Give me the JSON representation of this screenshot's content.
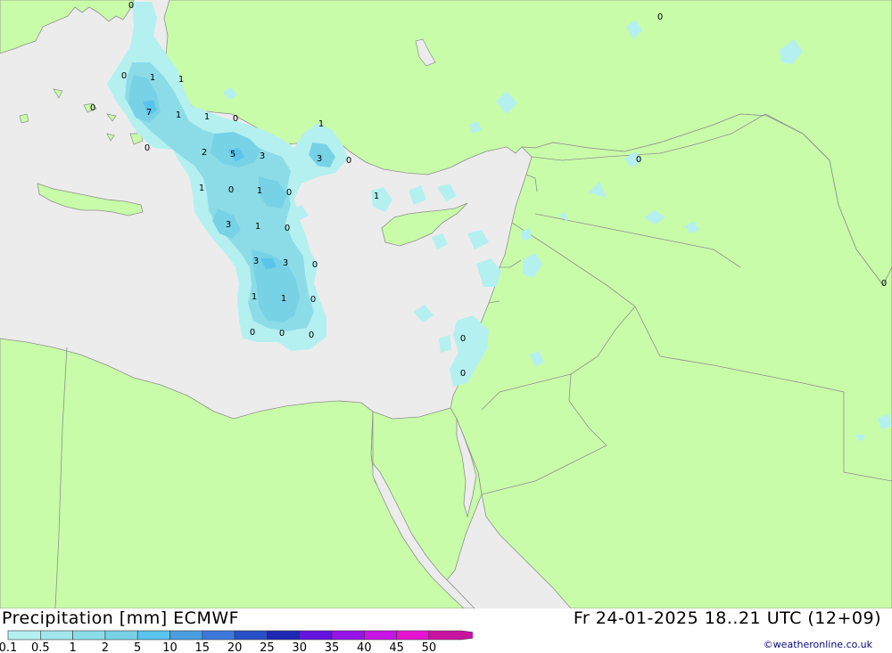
{
  "header": {
    "title": "Precipitation [mm] ECMWF",
    "valid_time": "Fr 24-01-2025 18..21 UTC (12+09)"
  },
  "legend": {
    "levels": [
      "0.1",
      "0.5",
      "1",
      "2",
      "5",
      "10",
      "15",
      "20",
      "25",
      "30",
      "35",
      "40",
      "45",
      "50"
    ],
    "colors": [
      "#b4f0f0",
      "#a0e6ec",
      "#8cdce8",
      "#78d2e6",
      "#5ac4ec",
      "#4a9ee0",
      "#3c78dc",
      "#2850c8",
      "#1e28b4",
      "#6414dc",
      "#9614e6",
      "#c814e6",
      "#e614d2",
      "#c814a0"
    ]
  },
  "credit": "©weatheronline.co.uk",
  "map": {
    "colors": {
      "land": "#c8fca8",
      "sea": "#ececec",
      "border": "#909090"
    },
    "values": [
      {
        "v": "0"
      },
      {
        "v": "0"
      },
      {
        "v": "0"
      },
      {
        "v": "1"
      },
      {
        "v": "1"
      },
      {
        "v": "0"
      },
      {
        "v": "7"
      },
      {
        "v": "1"
      },
      {
        "v": "1"
      },
      {
        "v": "0"
      },
      {
        "v": "0"
      },
      {
        "v": "1"
      },
      {
        "v": "2"
      },
      {
        "v": "5"
      },
      {
        "v": "3"
      },
      {
        "v": "3"
      },
      {
        "v": "0"
      },
      {
        "v": "0"
      },
      {
        "v": "1"
      },
      {
        "v": "0"
      },
      {
        "v": "1"
      },
      {
        "v": "0"
      },
      {
        "v": "1"
      },
      {
        "v": "3"
      },
      {
        "v": "1"
      },
      {
        "v": "0"
      },
      {
        "v": "3"
      },
      {
        "v": "3"
      },
      {
        "v": "0"
      },
      {
        "v": "1"
      },
      {
        "v": "1"
      },
      {
        "v": "0"
      },
      {
        "v": "0"
      },
      {
        "v": "0"
      },
      {
        "v": "0"
      },
      {
        "v": "0"
      },
      {
        "v": "0"
      },
      {
        "v": "0"
      }
    ]
  }
}
